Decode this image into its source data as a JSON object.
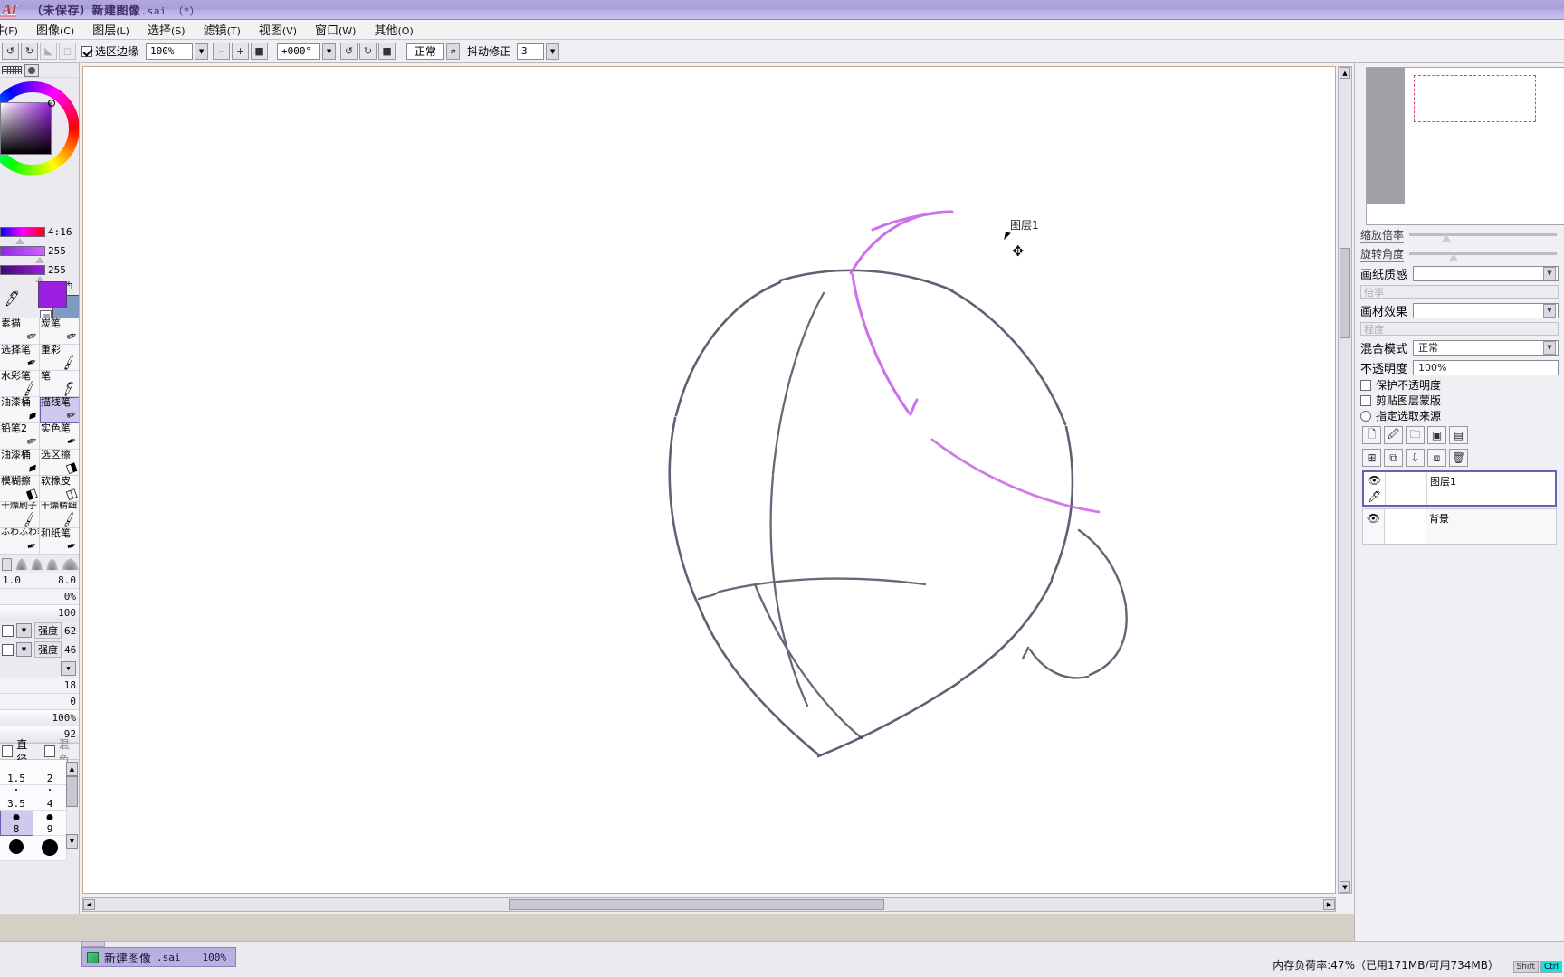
{
  "window": {
    "logo": "AI",
    "title": "（未保存）新建图像",
    "title_ext": ".sai （*）"
  },
  "menubar": {
    "items": [
      {
        "label": "件",
        "mnemonic": "(F)"
      },
      {
        "label": "图像",
        "mnemonic": "(C)"
      },
      {
        "label": "图层",
        "mnemonic": "(L)"
      },
      {
        "label": "选择",
        "mnemonic": "(S)"
      },
      {
        "label": "滤镜",
        "mnemonic": "(T)"
      },
      {
        "label": "视图",
        "mnemonic": "(V)"
      },
      {
        "label": "窗口",
        "mnemonic": "(W)"
      },
      {
        "label": "其他",
        "mnemonic": "(O)"
      }
    ]
  },
  "toolbar": {
    "undo_icon": "↺",
    "redo_icon": "↻",
    "back_icon": "◣",
    "forward_icon": "◻",
    "selection_edge_label": "选区边缘",
    "selection_edge_checked": true,
    "zoom_value": "100%",
    "zoom_dropdown_icon": "▼",
    "zoom_out_icon": "–",
    "zoom_in_icon": "+",
    "zoom_fit_icon": "■",
    "rotate_value": "+000°",
    "rotate_dropdown_icon": "▼",
    "rotate_ccw_icon": "↺",
    "rotate_cw_icon": "↻",
    "rotate_reset_icon": "■",
    "mode_value": "正常",
    "mode_dropdown_icon": "⇄",
    "stabilizer_label": "抖动修正",
    "stabilizer_value": "3",
    "stabilizer_dropdown_icon": "▼"
  },
  "leftpanel": {
    "top_icons": {
      "pattern": "dither-pattern",
      "blob": "blob-icon"
    },
    "color_sliders": [
      {
        "name": "hue-slider",
        "value": "4:16"
      },
      {
        "name": "saturation-slider",
        "value": "255"
      },
      {
        "name": "value-slider",
        "value": "255"
      }
    ],
    "swatch_primary": "#9b1fe0",
    "swatch_secondary": "#7f9bc4",
    "tools": [
      {
        "label": "素描",
        "icon": "pencil-icon",
        "selected": false
      },
      {
        "label": "炭笔",
        "icon": "pencil-icon",
        "selected": false
      },
      {
        "label": "选择笔",
        "icon": "select-pen-icon",
        "selected": false
      },
      {
        "label": "重彩",
        "icon": "brush-icon",
        "selected": false
      },
      {
        "label": "水彩笔",
        "icon": "watercolor-icon",
        "selected": false
      },
      {
        "label": "笔",
        "icon": "pen-icon",
        "selected": false
      },
      {
        "label": "油漆桶",
        "icon": "bucket-icon",
        "selected": false
      },
      {
        "label": "描线笔",
        "icon": "lineart-pen-icon",
        "selected": true
      },
      {
        "label": "铅笔2",
        "icon": "pencil2-icon",
        "selected": false
      },
      {
        "label": "实色笔",
        "icon": "solid-pen-icon",
        "selected": false
      },
      {
        "label": "油漆桶",
        "icon": "bucket-icon",
        "selected": false
      },
      {
        "label": "选区擦",
        "icon": "selection-eraser-icon",
        "selected": false
      },
      {
        "label": "模糊擦",
        "icon": "blur-eraser-icon",
        "selected": false
      },
      {
        "label": "软橡皮",
        "icon": "soft-eraser-icon",
        "selected": false
      },
      {
        "label": "干燥刷子",
        "icon": "dry-brush-icon",
        "selected": false
      },
      {
        "label": "干燥精细",
        "icon": "dry-fine-icon",
        "selected": false
      },
      {
        "label": "ふわふわ笔",
        "icon": "fuwa-pen-icon",
        "selected": false
      },
      {
        "label": "和纸笔",
        "icon": "washi-pen-icon",
        "selected": false
      }
    ],
    "brush_values": {
      "min_size": "1.0",
      "max_size": "8.0",
      "percent_small": "0%",
      "hundred": "100",
      "strength_label_1": "强度",
      "strength_value_1": "62",
      "strength_label_2": "强度",
      "strength_value_2": "46",
      "v18": "18",
      "v0": "0",
      "v100": "100%",
      "v92": "92"
    },
    "diameter_label": "直径",
    "mix_label": "混色",
    "sizes": [
      {
        "value": "1.5",
        "dot": 1,
        "selected": false
      },
      {
        "value": "2",
        "dot": 1,
        "selected": false
      },
      {
        "value": "3.5",
        "dot": 2,
        "selected": false
      },
      {
        "value": "4",
        "dot": 2,
        "selected": false
      },
      {
        "value": "8",
        "dot": 7,
        "selected": true
      },
      {
        "value": "9",
        "dot": 7,
        "selected": false
      },
      {
        "value": "",
        "dot": 16,
        "selected": false
      },
      {
        "value": "",
        "dot": 18,
        "selected": false
      }
    ]
  },
  "canvas": {
    "layer_label": "图层1",
    "cursor_icon": "arrow-cursor",
    "move_icon": "✥"
  },
  "rightpanel": {
    "zoom_label": "缩放倍率",
    "rotate_label": "旋转角度",
    "paper_texture_label": "画纸质感",
    "paper_texture_value": "",
    "paper_texture_sub": "倍率",
    "material_effect_label": "画材效果",
    "material_effect_value": "",
    "material_effect_sub": "程度",
    "blend_mode_label": "混合模式",
    "blend_mode_value": "正常",
    "opacity_label": "不透明度",
    "opacity_value": "100%",
    "lock_alpha_label": "保护不透明度",
    "clipping_label": "剪贴图层蒙版",
    "select_source_label": "指定选取来源",
    "layer_buttons": [
      "new-layer-icon",
      "new-linework-layer-icon",
      "new-folder-icon",
      "add-layer-mask-icon",
      "clipping-icon",
      "delete-layer-icon"
    ],
    "layers": [
      {
        "name": "图层1",
        "visible": true,
        "selected": true,
        "eye_icon": "eye-icon",
        "pen_icon": "pen-icon"
      },
      {
        "name": "背景",
        "visible": true,
        "selected": false,
        "eye_icon": "eye-icon",
        "pen_icon": ""
      }
    ]
  },
  "bottombar": {
    "doc_tab_name": "新建图像",
    "doc_tab_ext": ".sai",
    "doc_tab_zoom": "100%",
    "status": "内存负荷率:47%（已用171MB/可用734MB）",
    "keys": [
      {
        "label": "Shift",
        "active": false
      },
      {
        "label": "Ctrl",
        "active": true
      }
    ]
  }
}
